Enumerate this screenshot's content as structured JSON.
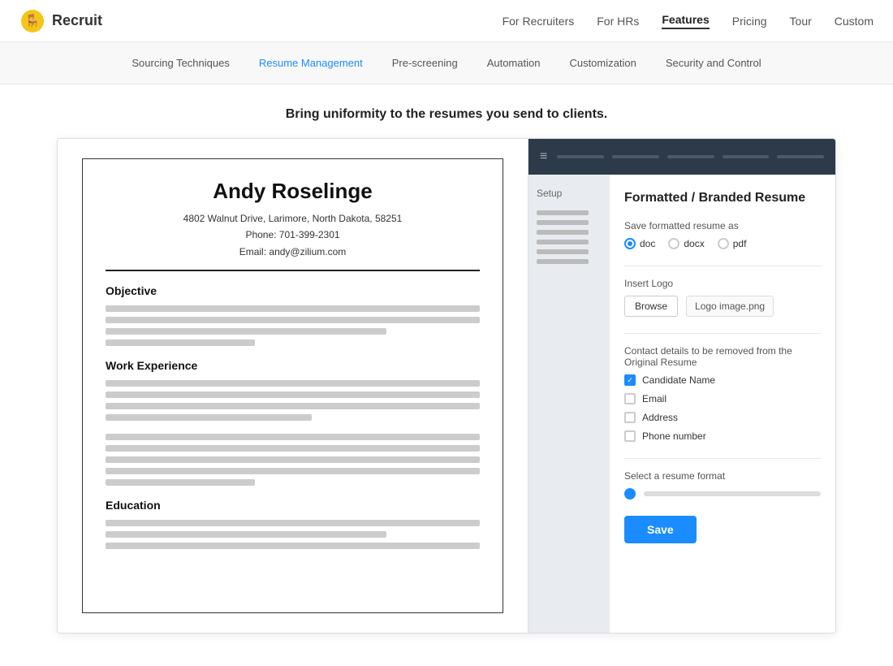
{
  "logo": {
    "text": "Recruit",
    "icon_label": "recruit-logo-icon"
  },
  "top_nav": {
    "links": [
      {
        "label": "For Recruiters",
        "active": false
      },
      {
        "label": "For HRs",
        "active": false
      },
      {
        "label": "Features",
        "active": true
      },
      {
        "label": "Pricing",
        "active": false
      },
      {
        "label": "Tour",
        "active": false
      },
      {
        "label": "Custom",
        "active": false
      }
    ]
  },
  "sub_nav": {
    "items": [
      {
        "label": "Sourcing Techniques",
        "active": false
      },
      {
        "label": "Resume Management",
        "active": true
      },
      {
        "label": "Pre-screening",
        "active": false
      },
      {
        "label": "Automation",
        "active": false
      },
      {
        "label": "Customization",
        "active": false
      },
      {
        "label": "Security and Control",
        "active": false
      }
    ]
  },
  "hero": {
    "title": "Bring uniformity to the resumes you send to clients."
  },
  "resume": {
    "name": "Andy Roselinge",
    "address": "4802 Walnut Drive, Larimore, North Dakota, 58251",
    "phone": "Phone: 701-399-2301",
    "email": "Email: andy@zilium.com",
    "sections": [
      {
        "title": "Objective"
      },
      {
        "title": "Work Experience"
      },
      {
        "title": "Education"
      }
    ]
  },
  "panel": {
    "header_bar_icon": "≡",
    "sidebar_label": "Setup",
    "form_title": "Formatted / Branded Resume",
    "save_as_label": "Save formatted resume as",
    "save_as_options": [
      {
        "label": "doc",
        "checked": true
      },
      {
        "label": "docx",
        "checked": false
      },
      {
        "label": "pdf",
        "checked": false
      }
    ],
    "insert_logo_label": "Insert Logo",
    "browse_label": "Browse",
    "logo_filename": "Logo image.png",
    "contact_removal_label": "Contact details to be removed from the Original Resume",
    "checkboxes": [
      {
        "label": "Candidate Name",
        "checked": true
      },
      {
        "label": "Email",
        "checked": false
      },
      {
        "label": "Address",
        "checked": false
      },
      {
        "label": "Phone number",
        "checked": false
      }
    ],
    "format_label": "Select a resume format",
    "save_button_label": "Save"
  }
}
